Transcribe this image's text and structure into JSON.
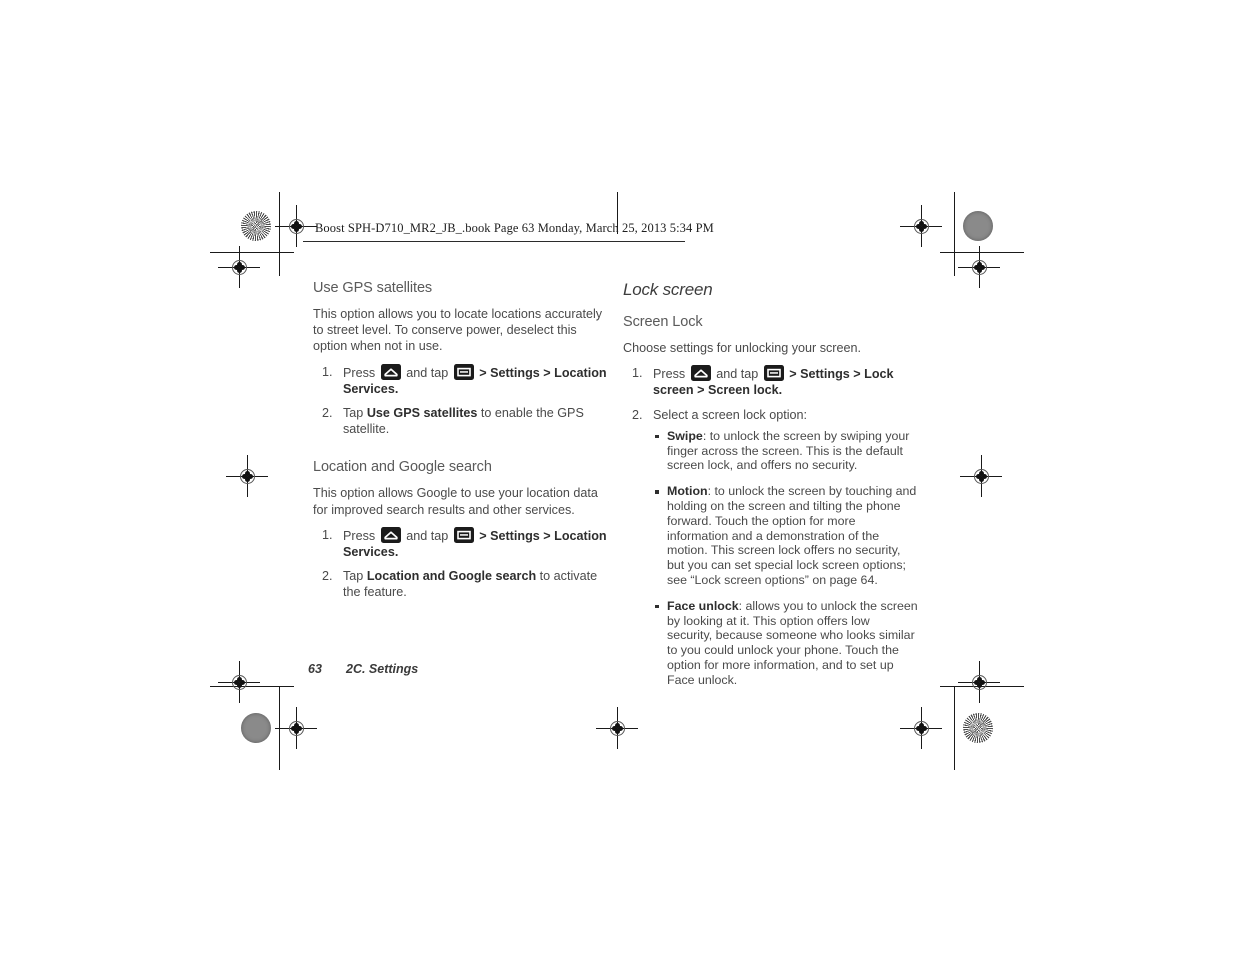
{
  "page_header": "Boost SPH-D710_MR2_JB_.book  Page 63  Monday, March 25, 2013  5:34 PM",
  "footer": {
    "page_number": "63",
    "section": "2C. Settings"
  },
  "icons": {
    "home": "home-key-icon",
    "menu": "menu-key-icon"
  },
  "colors": {
    "body_text": "#4a4a4a",
    "bold_text": "#2e2e2e",
    "heading": "#5a5a5a",
    "chapter_heading": "#3d3d3d",
    "icon_background": "#1b1b1b",
    "page_background": "#ffffff"
  },
  "left_column": {
    "sections": [
      {
        "heading": "Use GPS satellites",
        "body": "This option allows you to locate locations accurately to street level. To conserve power, deselect this option when not in use.",
        "steps": [
          {
            "prefix": "Press",
            "mid": "and tap",
            "path": "> Settings > Location Services."
          },
          {
            "text_before": "Tap ",
            "bold": "Use GPS satellites",
            "text_after": " to enable the GPS satellite."
          }
        ]
      },
      {
        "heading": "Location and Google search",
        "body": "This option allows Google to use your location data for improved search results and other services.",
        "steps": [
          {
            "prefix": "Press",
            "mid": "and tap",
            "path": "> Settings > Location Services."
          },
          {
            "text_before": "Tap ",
            "bold": "Location and Google search",
            "text_after": " to activate the feature."
          }
        ]
      }
    ]
  },
  "right_column": {
    "chapter_heading": "Lock screen",
    "sections": [
      {
        "heading": "Screen Lock",
        "body": "Choose settings for unlocking your screen.",
        "steps": [
          {
            "prefix": "Press",
            "mid": "and tap",
            "path": "> Settings > Lock screen > Screen lock."
          },
          {
            "text_before": "Select a screen lock option:",
            "bold": "",
            "text_after": ""
          }
        ],
        "bullets": [
          {
            "term": "Swipe",
            "description": ": to unlock the screen by swiping your finger across the screen. This is the default screen lock, and offers no security."
          },
          {
            "term": "Motion",
            "description": ": to unlock the screen by touching and holding on the screen and tilting the phone forward. Touch the option for more information and a demonstration of the motion. This screen lock offers no security, but you can set special lock screen options; see “Lock screen options” on page 64."
          },
          {
            "term": "Face unlock",
            "description": ": allows you to unlock the screen by looking at it. This option offers low security, because someone who looks similar to you could unlock your phone. Touch the option for more information, and to set up Face unlock."
          }
        ]
      }
    ]
  }
}
